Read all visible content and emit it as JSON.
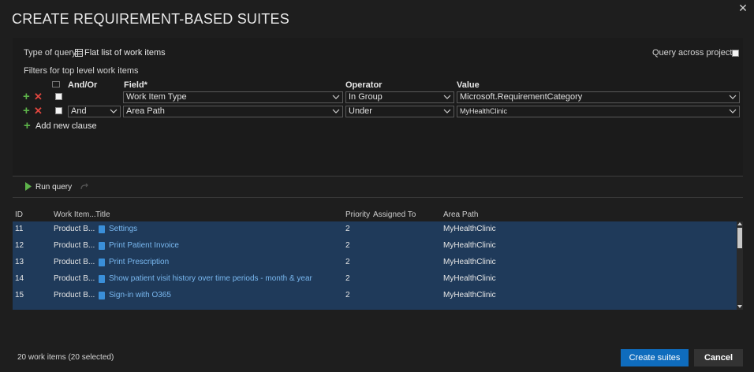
{
  "dialog": {
    "title": "CREATE REQUIREMENT-BASED SUITES",
    "close_glyph": "✕"
  },
  "query": {
    "type_label": "Type of query",
    "type_value": "Flat list of work items",
    "across_projects_label": "Query across projects",
    "filters_label": "Filters for top level work items",
    "columns": {
      "andor": "And/Or",
      "field": "Field*",
      "operator": "Operator",
      "value": "Value"
    },
    "clauses": [
      {
        "andor": "",
        "field": "Work Item Type",
        "operator": "In Group",
        "value": "Microsoft.RequirementCategory"
      },
      {
        "andor": "And",
        "field": "Area Path",
        "operator": "Under",
        "value": "MyHealthClinic"
      }
    ],
    "add_clause_label": "Add new clause"
  },
  "toolbar": {
    "run_query_label": "Run query"
  },
  "grid": {
    "columns": {
      "id": "ID",
      "type": "Work Item...",
      "title": "Title",
      "priority": "Priority",
      "assigned": "Assigned To",
      "area": "Area Path"
    },
    "rows": [
      {
        "id": "11",
        "type": "Product B...",
        "title": "Settings",
        "priority": "2",
        "assigned": "",
        "area": "MyHealthClinic"
      },
      {
        "id": "12",
        "type": "Product B...",
        "title": "Print Patient Invoice",
        "priority": "2",
        "assigned": "",
        "area": "MyHealthClinic"
      },
      {
        "id": "13",
        "type": "Product B...",
        "title": "Print Prescription",
        "priority": "2",
        "assigned": "",
        "area": "MyHealthClinic"
      },
      {
        "id": "14",
        "type": "Product B...",
        "title": "Show patient visit history over time periods - month & year",
        "priority": "2",
        "assigned": "",
        "area": "MyHealthClinic"
      },
      {
        "id": "15",
        "type": "Product B...",
        "title": "Sign-in with O365",
        "priority": "2",
        "assigned": "",
        "area": "MyHealthClinic"
      }
    ]
  },
  "footer": {
    "status": "20 work items (20 selected)",
    "create_label": "Create suites",
    "cancel_label": "Cancel"
  },
  "colors": {
    "accent": "#0f6cbd",
    "selection": "#1f3a5a",
    "add": "#5db34a",
    "remove": "#e0463f"
  }
}
